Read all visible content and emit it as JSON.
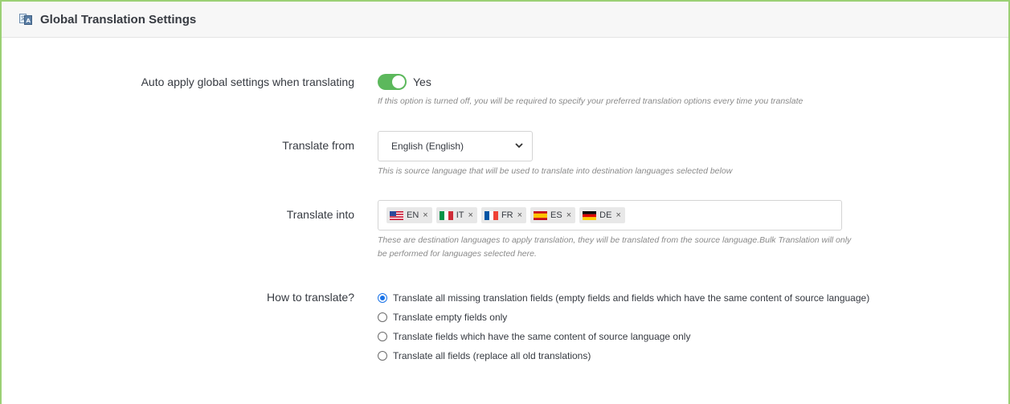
{
  "header": {
    "title": "Global Translation Settings",
    "icon": "translate-icon"
  },
  "auto_apply": {
    "label": "Auto apply global settings when translating",
    "enabled": true,
    "state_label": "Yes",
    "help": "If this option is turned off, you will be required to specify your preferred translation options every time you translate"
  },
  "translate_from": {
    "label": "Translate from",
    "selected": "English (English)",
    "help": "This is source language that will be used to translate into destination languages selected below"
  },
  "translate_into": {
    "label": "Translate into",
    "tags": [
      {
        "code": "EN",
        "flag": "us-flag-icon"
      },
      {
        "code": "IT",
        "flag": "italy-flag-icon"
      },
      {
        "code": "FR",
        "flag": "france-flag-icon"
      },
      {
        "code": "ES",
        "flag": "spain-flag-icon"
      },
      {
        "code": "DE",
        "flag": "germany-flag-icon"
      }
    ],
    "remove_glyph": "×",
    "help_line1": "These are destination languages to apply translation, they will be translated from the source language.Bulk Translation will only",
    "help_line2": "be performed for languages selected here."
  },
  "how_to_translate": {
    "label": "How to translate?",
    "options": [
      {
        "label": "Translate all missing translation fields (empty fields and fields which have the same content of source language)",
        "checked": true
      },
      {
        "label": "Translate empty fields only",
        "checked": false
      },
      {
        "label": "Translate fields which have the same content of source language only",
        "checked": false
      },
      {
        "label": "Translate all fields (replace all old translations)",
        "checked": false
      }
    ]
  },
  "colors": {
    "border": "#9bd075",
    "switch_on": "#5cb85c",
    "radio_checked": "#1a73e8"
  }
}
